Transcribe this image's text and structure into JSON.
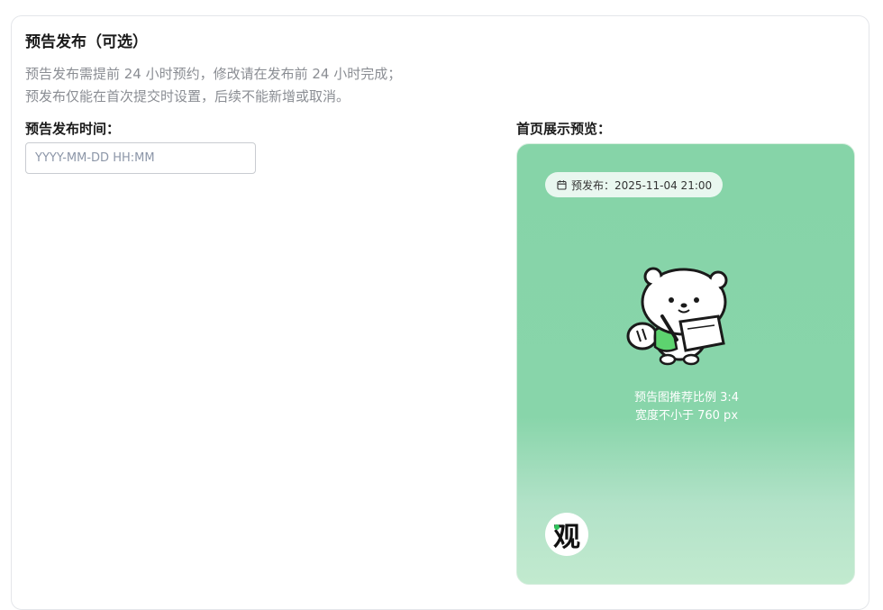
{
  "section": {
    "title": "预告发布（可选）",
    "desc_line1": "预告发布需提前 24 小时预约，修改请在发布前 24 小时完成；",
    "desc_line2": "预发布仅能在首次提交时设置，后续不能新增或取消。"
  },
  "time_field": {
    "label": "预告发布时间：",
    "value": "",
    "placeholder": "YYYY-MM-DD HH:MM"
  },
  "preview": {
    "label": "首页展示预览：",
    "badge_icon": "calendar-icon",
    "badge_text": "预发布：2025-11-04 21:00",
    "mascot": "bear-with-notebook-illustration",
    "hint_line1": "预告图推荐比例 3:4",
    "hint_line2": "宽度不小于 760 px",
    "logo_text": "观",
    "colors": {
      "bg_top": "#86d4a8",
      "bg_bottom": "#c2eacf",
      "logo_dot": "#2fc25b"
    }
  }
}
